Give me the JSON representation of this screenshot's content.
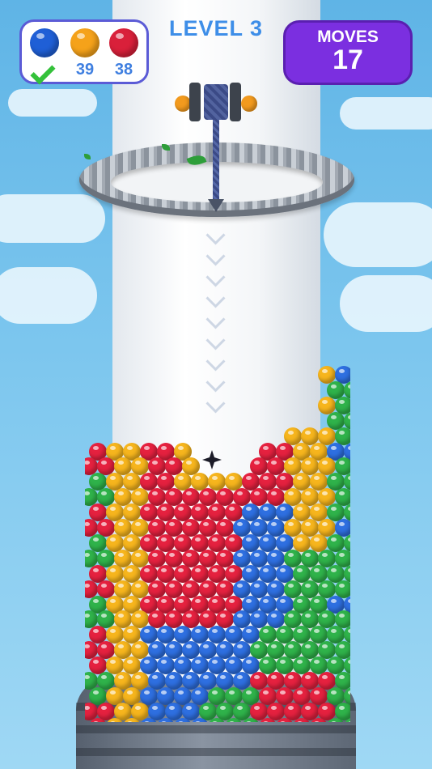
{
  "hud": {
    "level_text": "LEVEL 3",
    "moves_label": "MOVES",
    "moves_value": "17"
  },
  "ball_counters": [
    {
      "color_name": "blue",
      "color": "#1f5fd6",
      "status": "completed",
      "count": null
    },
    {
      "color_name": "orange",
      "color": "#f5a21a",
      "status": "remaining",
      "count": "39"
    },
    {
      "color_name": "red",
      "color": "#d9203a",
      "status": "remaining",
      "count": "38"
    }
  ],
  "palette": {
    "red": "#e5213f",
    "blue": "#2e6fe0",
    "yellow": "#f6b51d",
    "green": "#2fb24a",
    "sky": "#6cbde9",
    "hud_border": "#5b5bd6",
    "moves_bg": "#7b2fe0"
  },
  "icons": [
    "check-icon",
    "winch-icon",
    "saw-ring-icon",
    "drill-arrow-icon"
  ]
}
